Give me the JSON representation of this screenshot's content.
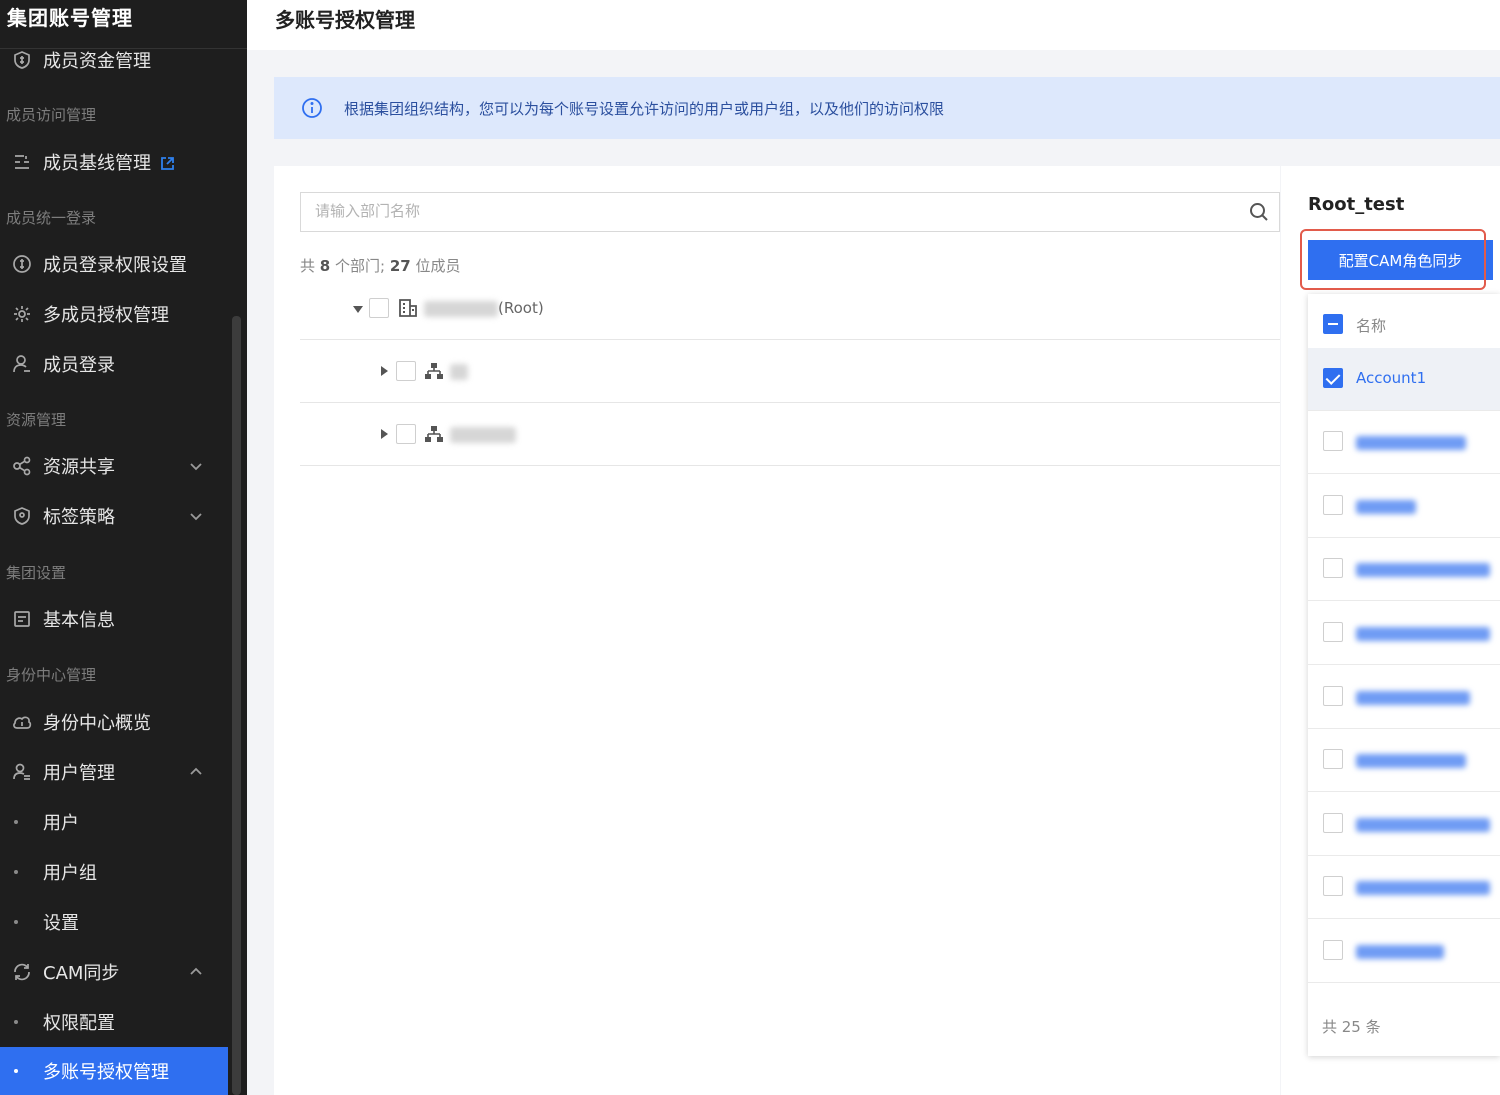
{
  "sidebar": {
    "title": "集团账号管理",
    "groups": {
      "access": "成员访问管理",
      "sso": "成员统一登录",
      "resource": "资源管理",
      "group_settings": "集团设置",
      "identity": "身份中心管理"
    },
    "items": {
      "funds": "成员资金管理",
      "baseline": "成员基线管理",
      "login_perm": "成员登录权限设置",
      "multi_auth": "多成员授权管理",
      "member_login": "成员登录",
      "resource_share": "资源共享",
      "tag_policy": "标签策略",
      "basic_info": "基本信息",
      "identity_overview": "身份中心概览",
      "user_mgmt": "用户管理",
      "users": "用户",
      "user_groups": "用户组",
      "settings": "设置",
      "cam_sync": "CAM同步",
      "perm_config": "权限配置",
      "multi_account_auth": "多账号授权管理"
    },
    "icons": {
      "funds": "shield-dollar-icon",
      "baseline": "baseline-icon",
      "login_perm": "dollar-circle-icon",
      "multi_auth": "gear-icon",
      "member_login": "user-icon",
      "resource_share": "share-icon",
      "tag_policy": "tag-shield-icon",
      "basic_info": "document-icon",
      "identity_overview": "cloud-icon",
      "user_mgmt": "users-icon",
      "cam_sync": "sync-icon",
      "external_link": "external-link-icon",
      "chevron": "chevron-icon"
    },
    "active_color": "#2f6ff0"
  },
  "header": {
    "title": "多账号授权管理"
  },
  "banner": {
    "text": "根据集团组织结构，您可以为每个账号设置允许访问的用户或用户组，以及他们的访问权限",
    "icon": "info-icon"
  },
  "search": {
    "placeholder": "请输入部门名称",
    "icon": "search-icon"
  },
  "summary": {
    "prefix": "共",
    "departments": "8",
    "dept_unit": "个部门;",
    "members": "27",
    "member_unit": "位成员"
  },
  "tree": {
    "root_suffix": "(Root)"
  },
  "right_panel": {
    "title": "Root_test",
    "button_label": "配置CAM角色同步",
    "list_header": "名称",
    "selected_item": "Account1",
    "total": "共 25 条"
  },
  "colors": {
    "accent": "#2f6ff0",
    "highlight_border": "#e25b4b",
    "banner_bg": "#dde8fc"
  }
}
